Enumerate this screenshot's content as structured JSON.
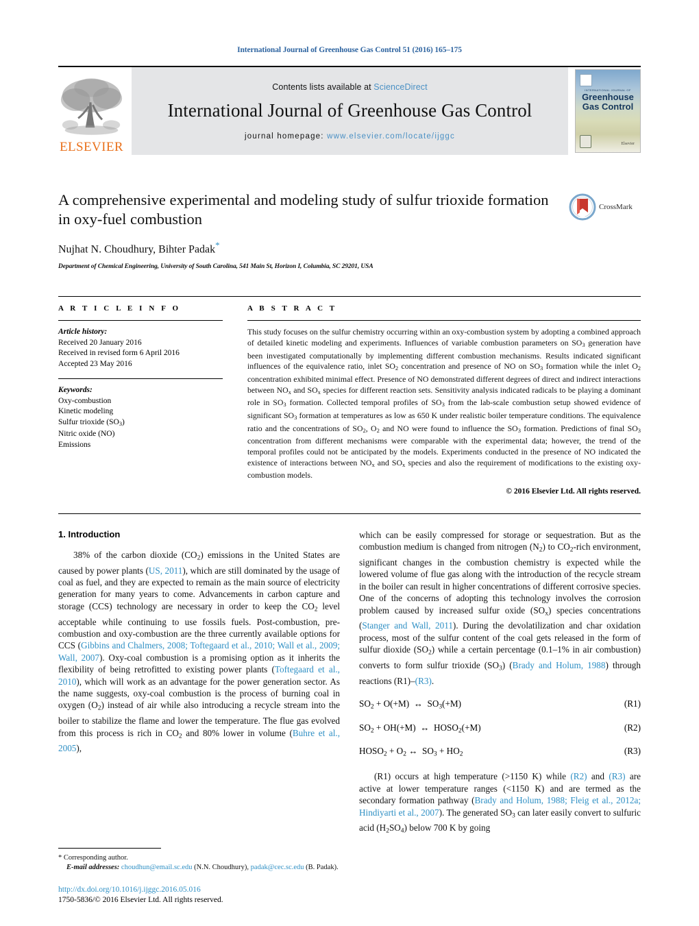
{
  "running_head": "International Journal of Greenhouse Gas Control 51 (2016) 165–175",
  "masthead": {
    "contents_prefix": "Contents lists available at ",
    "sciencedirect": "ScienceDirect",
    "journal_title": "International Journal of Greenhouse Gas Control",
    "homepage_prefix": "journal homepage: ",
    "homepage_url": "www.elsevier.com/locate/ijggc",
    "publisher_word": "ELSEVIER",
    "cover": {
      "superline": "INTERNATIONAL JOURNAL OF",
      "title_line1": "Greenhouse",
      "title_line2": "Gas Control",
      "publisher_mark": "Elsevier"
    }
  },
  "article": {
    "title": "A comprehensive experimental and modeling study of sulfur trioxide formation in oxy-fuel combustion",
    "authors": "Nujhat N. Choudhury, Bihter Padak",
    "corresponding_marker": "*",
    "affiliation": "Department of Chemical Engineering, University of South Carolina, 541 Main St, Horizon I, Columbia, SC 29201, USA",
    "crossmark_label": "CrossMark"
  },
  "article_info": {
    "heading": "A R T I C L E  I N F O",
    "history_label": "Article history:",
    "history": [
      "Received 20 January 2016",
      "Received in revised form 6 April 2016",
      "Accepted 23 May 2016"
    ],
    "keywords_label": "Keywords:",
    "keywords": [
      "Oxy-combustion",
      "Kinetic modeling",
      "Sulfur trioxide (SO3)",
      "Nitric oxide (NO)",
      "Emissions"
    ]
  },
  "abstract": {
    "heading": "A B S T R A C T",
    "text": "This study focuses on the sulfur chemistry occurring within an oxy-combustion system by adopting a combined approach of detailed kinetic modeling and experiments. Influences of variable combustion parameters on SO3 generation have been investigated computationally by implementing different combustion mechanisms. Results indicated significant influences of the equivalence ratio, inlet SO2 concentration and presence of NO on SO3 formation while the inlet O2 concentration exhibited minimal effect. Presence of NO demonstrated different degrees of direct and indirect interactions between NOx and SOx species for different reaction sets. Sensitivity analysis indicated radicals to be playing a dominant role in SO3 formation. Collected temporal profiles of SO3 from the lab-scale combustion setup showed evidence of significant SO3 formation at temperatures as low as 650 K under realistic boiler temperature conditions. The equivalence ratio and the concentrations of SO2, O2 and NO were found to influence the SO3 formation. Predictions of final SO3 concentration from different mechanisms were comparable with the experimental data; however, the trend of the temporal profiles could not be anticipated by the models. Experiments conducted in the presence of NO indicated the existence of interactions between NOx and SOx species and also the requirement of modifications to the existing oxy-combustion models.",
    "copyright": "© 2016 Elsevier Ltd. All rights reserved."
  },
  "introduction": {
    "heading": "1.  Introduction",
    "left_paragraph_1_part1": "38% of the carbon dioxide (CO2) emissions in the United States are caused by power plants (",
    "ref_us_2011": "US, 2011",
    "left_paragraph_1_part2": "), which are still dominated by the usage of coal as fuel, and they are expected to remain as the main source of electricity generation for many years to come. Advancements in carbon capture and storage (CCS) technology are necessary in order to keep the CO2 level acceptable while continuing to use fossils fuels. Post-combustion, pre-combustion and oxy-combustion are the three currently available options for CCS (",
    "ref_ccs_group": "Gibbins and Chalmers, 2008; Toftegaard et al., 2010; Wall et al., 2009; Wall, 2007",
    "left_paragraph_1_part3": "). Oxy-coal combustion is a promising option as it inherits the flexibility of being retrofitted to existing power plants (",
    "ref_toftegaard": "Toftegaard et al., 2010",
    "left_paragraph_1_part4": "), which will work as an advantage for the power generation sector. As the name suggests, oxy-coal combustion is the process of burning coal in oxygen (O2) instead of air while also introducing a recycle stream into the boiler to stabilize the flame and lower the temperature. The flue gas evolved from this process is rich in CO2 and 80% lower in volume (",
    "ref_buhre": "Buhre et al., 2005",
    "left_paragraph_1_part5": "),",
    "right_paragraph_1_part1": "which can be easily compressed for storage or sequestration. But as the combustion medium is changed from nitrogen (N2) to CO2-rich environment, significant changes in the combustion chemistry is expected while the lowered volume of flue gas along with the introduction of the recycle stream in the boiler can result in higher concentrations of different corrosive species. One of the concerns of adopting this technology involves the corrosion problem caused by increased sulfur oxide (SOx) species concentrations (",
    "ref_stanger": "Stanger and Wall, 2011",
    "right_paragraph_1_part2": "). During the devolatilization and char oxidation process, most of the sulfur content of the coal gets released in the form of sulfur dioxide (SO2) while a certain percentage (0.1–1% in air combustion) converts to form sulfur trioxide (SO3) (",
    "ref_brady": "Brady and Holum, 1988",
    "right_paragraph_1_part3": ") through reactions (R1)–",
    "ref_r3_link": "(R3)",
    "right_paragraph_1_part4": ".",
    "right_paragraph_2_part1": "(R1) occurs at high temperature (>1150 K) while ",
    "ref_r2_link": "(R2)",
    "right_paragraph_2_part2": " and ",
    "ref_r3_link2": "(R3)",
    "right_paragraph_2_part3": " are active at lower temperature ranges (<1150 K) and are termed as the secondary formation pathway (",
    "ref_brady_fleig": "Brady and Holum, 1988; Fleig et al., 2012a; Hindiyarti et al., 2007",
    "right_paragraph_2_part4": "). The generated SO3 can later easily convert to sulfuric acid (H2SO4) below 700 K by going"
  },
  "equations": [
    {
      "body": "SO2 + O(+M)  ↔  SO3(+M)",
      "label": "(R1)"
    },
    {
      "body": "SO2 + OH(+M)  ↔  HOSO2(+M)",
      "label": "(R2)"
    },
    {
      "body": "HOSO2 + O2 ↔  SO3 + HO2",
      "label": "(R3)"
    }
  ],
  "footnotes": {
    "corresponding": "* Corresponding author.",
    "email_label": "E-mail addresses:",
    "email_1": "choudhun@email.sc.edu",
    "email_1_name": "(N.N. Choudhury),",
    "email_2": "padak@cec.sc.edu",
    "email_2_name": "(B. Padak)."
  },
  "doi": {
    "url": "http://dx.doi.org/10.1016/j.ijggc.2016.05.016",
    "issn_line": "1750-5836/© 2016 Elsevier Ltd. All rights reserved."
  },
  "colors": {
    "link_blue": "#2e8fc4",
    "header_blue": "#2e64a0",
    "elsevier_orange": "#e9711c",
    "banner_gray": "#e4e5e7"
  }
}
